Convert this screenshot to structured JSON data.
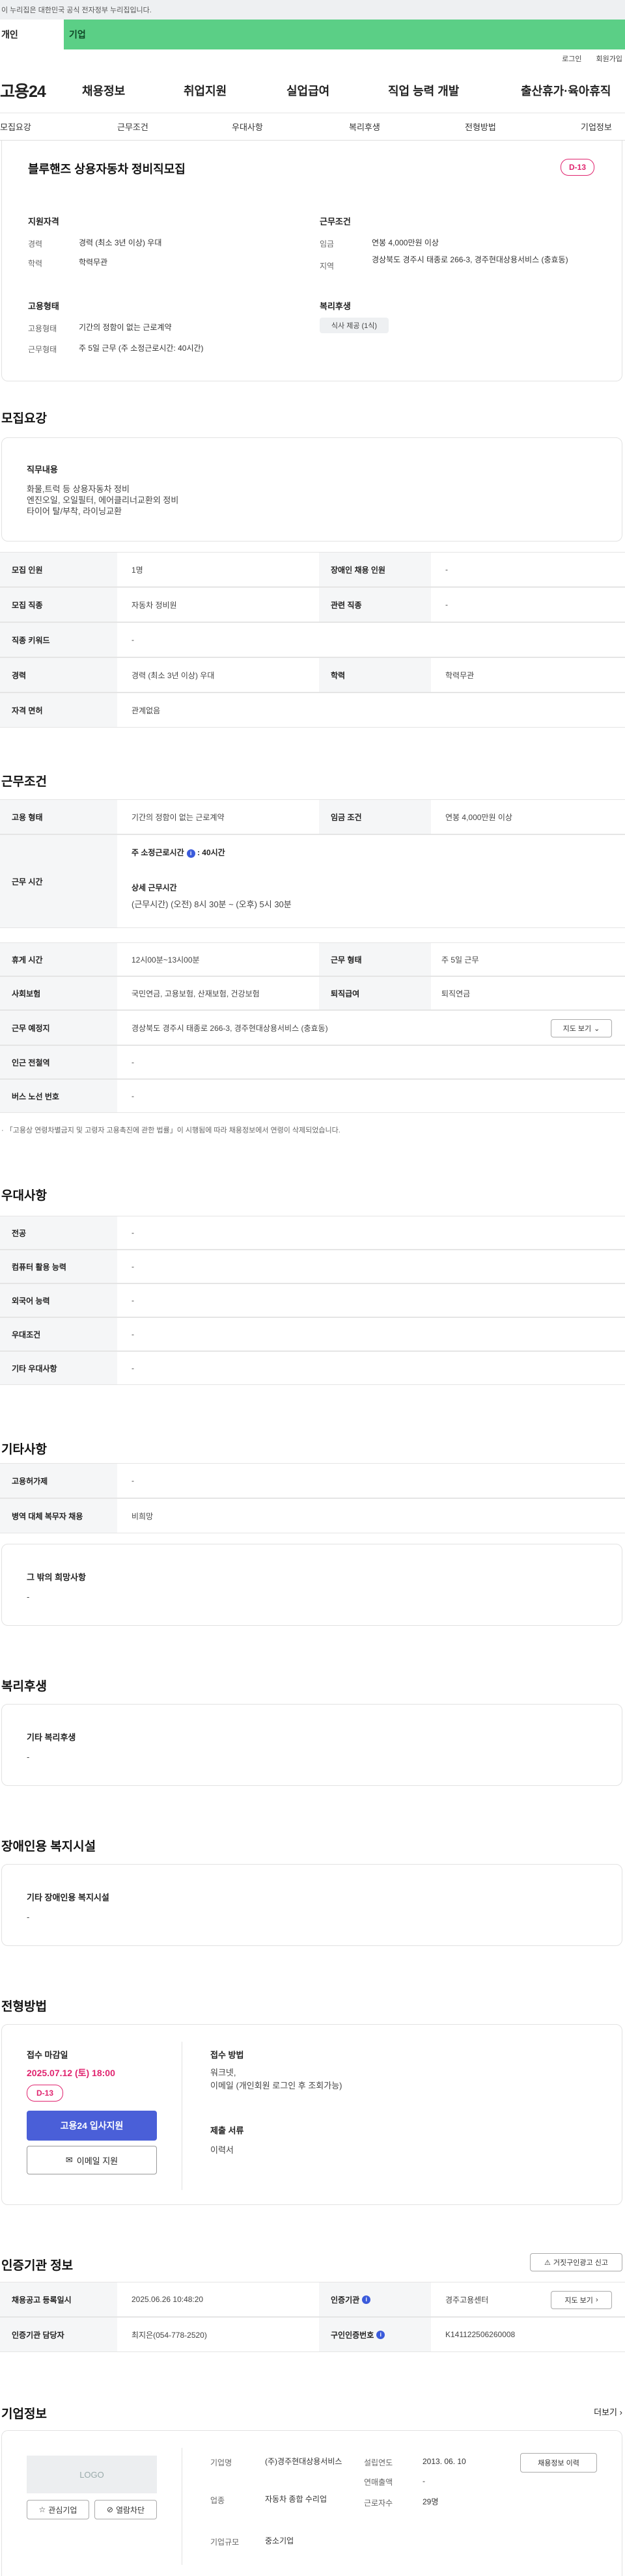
{
  "banner": "이 누리집은 대한민국 공식 전자정부 누리집입니다.",
  "tabs": {
    "personal": "개인",
    "biz": "기업"
  },
  "util": {
    "login": "로그인",
    "join": "회원가입"
  },
  "gnb": {
    "logo": "고용24",
    "items": [
      "채용정보",
      "취업지원",
      "실업급여",
      "직업 능력 개발",
      "출산휴가·육아휴직"
    ]
  },
  "subnav": [
    "모집요강",
    "근무조건",
    "우대사항",
    "복리후생",
    "전형방법",
    "기업정보"
  ],
  "summary": {
    "title": "블루핸즈 상용자동차 정비직모집",
    "dday": "D-13",
    "recruit_h": "지원자격",
    "career_k": "경력",
    "career_v": "경력 (최소 3년 이상) 우대",
    "edu_k": "학력",
    "edu_v": "학력무관",
    "emp_h": "고용형태",
    "type_k": "고용형태",
    "type_v": "기간의 정함이 없는 근로계약",
    "form_k": "근무형태",
    "form_v": "주 5일 근무 (주 소정근로시간: 40시간)",
    "cond_h": "근무조건",
    "wage_k": "임금",
    "wage_v": "연봉 4,000만원 이상",
    "area_k": "지역",
    "area_v": "경상북도 경주시 태종로 266-3, 경주현대상용서비스 (충효동)",
    "wel_h": "복리후생",
    "wel_chip": "식사 제공 (1식)"
  },
  "recruit": {
    "title": "모집요강",
    "duty_h": "직무내용",
    "duty_t": "화물,트럭 등 상용자동차 정비\n엔진오일, 오일필터, 에어클리너교환외 정비\n타이어 탈/부착, 라이닝교환",
    "rows": [
      [
        "모집 인원",
        "1명",
        "장애인 채용 인원",
        "-"
      ],
      [
        "모집 직종",
        "자동차 정비원",
        "관련 직종",
        "-"
      ],
      [
        "직종 키워드",
        "-"
      ],
      [
        "경력",
        "경력 (최소 3년 이상) 우대",
        "학력",
        "학력무관"
      ],
      [
        "자격 면허",
        "관계없음"
      ]
    ]
  },
  "condition": {
    "title": "근무조건",
    "emp_k": "고용 형태",
    "emp_v": "기간의 정함이 없는 근로계약",
    "wage_k": "임금 조건",
    "wage_v": "연봉 4,000만원 이상",
    "hours_k": "근무 시간",
    "hours_a": "주 소정근로시간",
    "hours_b": "40시간",
    "hours_c": "상세 근무시간",
    "hours_d": "(근무시간) (오전) 8시 30분 ~ (오후) 5시 30분",
    "rows": [
      [
        "휴게 시간",
        "12시00분~13시00분",
        "근무 형태",
        "주 5일 근무"
      ],
      [
        "사회보험",
        "국민연금, 고용보험, 산재보험, 건강보험",
        "퇴직급여",
        "퇴직연금"
      ]
    ],
    "loc_k": "근무 예정지",
    "loc_v": "경상북도 경주시 태종로 266-3, 경주현대상용서비스 (충효동)",
    "map_btn": "지도 보기",
    "sub_k": "인근 전철역",
    "sub_v": "-",
    "bus_k": "버스 노선 번호",
    "bus_v": "-",
    "note": "「고용상 연령차별금지 및 고령자 고용촉진에 관한 법률」이 시행됨에 따라 채용정보에서 연령이 삭제되었습니다."
  },
  "pref": {
    "title": "우대사항",
    "rows": [
      [
        "전공",
        "-"
      ],
      [
        "컴퓨터 활용 능력",
        "-"
      ],
      [
        "외국어 능력",
        "-"
      ],
      [
        "우대조건",
        "-"
      ],
      [
        "기타 우대사항",
        "-"
      ]
    ]
  },
  "etc": {
    "title": "기타사항",
    "rows": [
      [
        "고용허가제",
        "-"
      ],
      [
        "병역 대체 복무자 채용",
        "비희망"
      ]
    ],
    "box_h": "그 밖의 희망사항",
    "box_t": "-"
  },
  "welfare": {
    "title": "복리후생",
    "box_h": "기타 복리후생",
    "box_t": "-"
  },
  "disabled": {
    "title": "장애인용 복지시설",
    "box_h": "기타 장애인용 복지시설",
    "box_t": "-"
  },
  "method": {
    "title": "전형방법",
    "deadline_h": "접수 마감일",
    "deadline": "2025.07.12 (토) 18:00",
    "dday": "D-13",
    "apply_btn": "고용24 입사지원",
    "email_btn": "이메일 지원",
    "way_h": "접수 방법",
    "way_t": "워크넷,\n이메일 (개인회원 로그인 후 조회가능)",
    "doc_h": "제출 서류",
    "doc_t": "이력서"
  },
  "agency": {
    "title": "인증기관 정보",
    "report_btn": "거짓구인광고 신고",
    "reg_k": "채용공고 등록일시",
    "reg_v": "2025.06.26 10:48:20",
    "org_k": "인증기관",
    "org_v": "경주고용센터",
    "map_btn": "지도 보기",
    "mgr_k": "인증기관 담당자",
    "mgr_v": "최지은(054-778-2520)",
    "num_k": "구인인증번호",
    "num_v": "K141122506260008"
  },
  "company": {
    "title": "기업정보",
    "more": "더보기",
    "logo": "LOGO",
    "fav_btn": "관심기업",
    "block_btn": "열람차단",
    "name_k": "기업명",
    "name_v": "(주)경주현대상용서비스",
    "ind_k": "업종",
    "ind_v": "자동차 종합 수리업",
    "size_k": "기업규모",
    "size_v": "중소기업",
    "est_k": "설립연도",
    "est_v": "2013. 06. 10",
    "sales_k": "연매출액",
    "sales_v": "-",
    "emp_k": "근로자수",
    "emp_v": "29명",
    "recruit_btn": "채용정보 이력"
  }
}
